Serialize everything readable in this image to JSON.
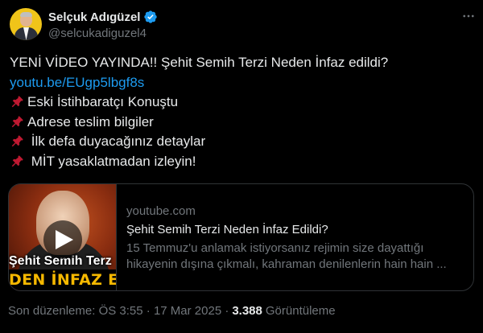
{
  "author": {
    "display_name": "Selçuk Adıgüzel",
    "handle": "@selcukadiguzel4"
  },
  "more_icon": "more-dots-icon",
  "tweet": {
    "headline": "YENİ VİDEO YAYINDA!! Şehit Semih Terzi Neden İnfaz edildi?",
    "link": "youtu.be/EUgp5lbgf8s",
    "bullets": [
      "Eski İstihbaratçı Konuştu",
      "Adrese teslim bilgiler",
      " İlk defa duyacağınız detaylar",
      " MİT yasaklatmadan izleyin!"
    ],
    "bullet_icon": "pushpin-icon"
  },
  "card": {
    "domain": "youtube.com",
    "title": "Şehit Semih Terzi Neden İnfaz Edildi?",
    "description_line1": "15 Temmuz'u anlamak istiyorsanız rejimin size dayattığı",
    "description_line2": "hikayenin dışına çıkmalı, kahraman denilenlerin hain hain ...",
    "thumbnail_text_top": "Şehit Semih Terz",
    "thumbnail_text_bottom": "DEN İNFAZ EDİ",
    "thumbnail_icon": "play-icon"
  },
  "meta": {
    "edited": "Son düzenleme: ÖS 3:55 · 17 Mar 2025 ·",
    "views_count": "3.388",
    "views_label": "Görüntüleme"
  },
  "colors": {
    "background": "#000000",
    "text": "#e7e9ea",
    "secondary": "#71767b",
    "link": "#1d9bf0",
    "border": "#2f3336"
  }
}
